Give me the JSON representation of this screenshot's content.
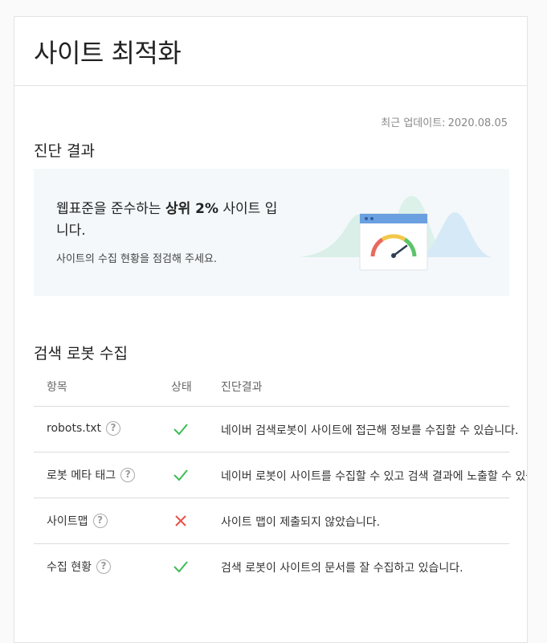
{
  "page": {
    "title": "사이트 최적화"
  },
  "update": {
    "prefix": "최근 업데이트:",
    "date": "2020.08.05"
  },
  "diagnosis": {
    "title": "진단 결과",
    "headline_pre": "웹표준을 준수하는 ",
    "headline_bold": "상위 2%",
    "headline_post": " 사이트 입니다.",
    "subtext": "사이트의 수집 현황을 점검해 주세요.",
    "colors": {
      "panel": "#f4f8fb",
      "gauge_red": "#e86a5c",
      "gauge_yellow": "#f2c84b",
      "gauge_green": "#5dc36a",
      "window_bar": "#6aa0e0"
    }
  },
  "robot": {
    "title": "검색 로봇 수집",
    "columns": [
      "항목",
      "상태",
      "진단결과"
    ],
    "rows": [
      {
        "item": "robots.txt",
        "status": "check",
        "result": "네이버 검색로봇이 사이트에 접근해 정보를 수집할 수 있습니다."
      },
      {
        "item": "로봇 메타 태그",
        "status": "check",
        "result": "네이버 로봇이 사이트를 수집할 수 있고 검색 결과에 노출할 수 있습니다."
      },
      {
        "item": "사이트맵",
        "status": "cross",
        "result": "사이트 맵이 제출되지 않았습니다."
      },
      {
        "item": "수집 현황",
        "status": "check",
        "result": "검색 로봇이 사이트의 문서를 잘 수집하고 있습니다."
      }
    ],
    "help_glyph": "?",
    "colors": {
      "check": "#3dbb55",
      "cross": "#e8524a"
    }
  }
}
